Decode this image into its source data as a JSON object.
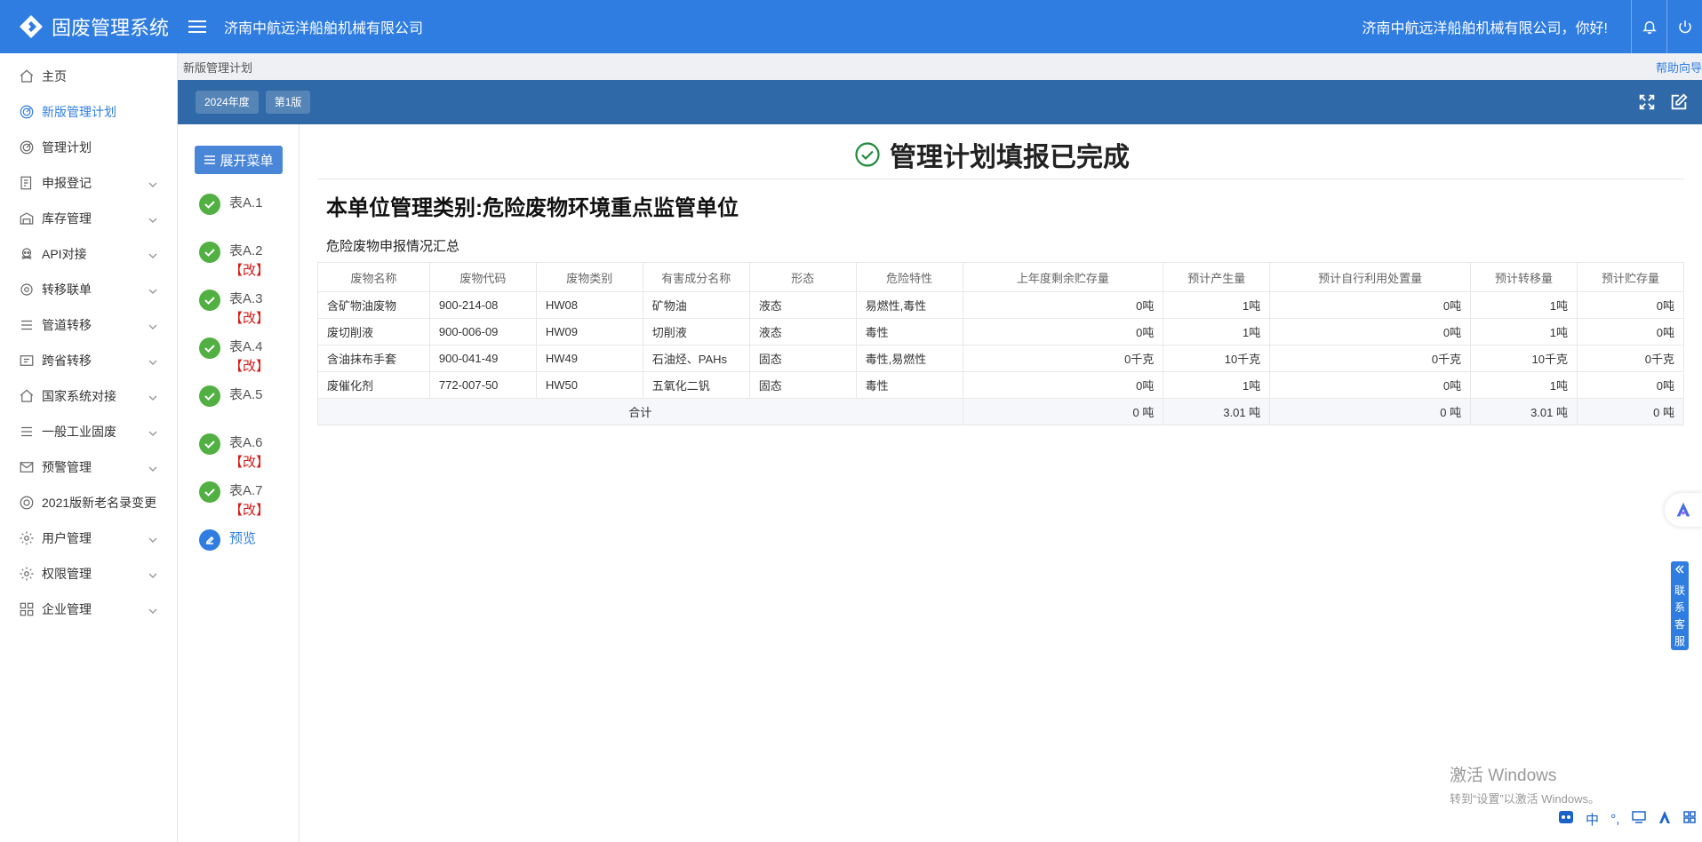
{
  "header": {
    "app_title": "固废管理系统",
    "company": "济南中航远洋船舶机械有限公司",
    "greeting": "济南中航远洋船舶机械有限公司，你好!"
  },
  "sidebar": {
    "items": [
      {
        "label": "主页"
      },
      {
        "label": "新版管理计划"
      },
      {
        "label": "管理计划"
      },
      {
        "label": "申报登记"
      },
      {
        "label": "库存管理"
      },
      {
        "label": "API对接"
      },
      {
        "label": "转移联单"
      },
      {
        "label": "管道转移"
      },
      {
        "label": "跨省转移"
      },
      {
        "label": "国家系统对接"
      },
      {
        "label": "一般工业固废"
      },
      {
        "label": "预警管理"
      },
      {
        "label": "2021版新老名录变更"
      },
      {
        "label": "用户管理"
      },
      {
        "label": "权限管理"
      },
      {
        "label": "企业管理"
      }
    ]
  },
  "breadcrumb": {
    "current": "新版管理计划",
    "help": "帮助向导"
  },
  "toolbar": {
    "year": "2024年度",
    "version": "第1版"
  },
  "steps": {
    "expand": "展开菜单",
    "modified": "【改】",
    "items": [
      {
        "label": "表A.1"
      },
      {
        "label": "表A.2"
      },
      {
        "label": "表A.3"
      },
      {
        "label": "表A.4"
      },
      {
        "label": "表A.5"
      },
      {
        "label": "表A.6"
      },
      {
        "label": "表A.7"
      },
      {
        "label": "预览"
      }
    ]
  },
  "main": {
    "status_title": "管理计划填报已完成",
    "category_title": "本单位管理类别:危险废物环境重点监管单位",
    "summary_title": "危险废物申报情况汇总",
    "table": {
      "headers": [
        "废物名称",
        "废物代码",
        "废物类别",
        "有害成分名称",
        "形态",
        "危险特性",
        "上年度剩余贮存量",
        "预计产生量",
        "预计自行利用处置量",
        "预计转移量",
        "预计贮存量"
      ],
      "rows": [
        [
          "含矿物油废物",
          "900-214-08",
          "HW08",
          "矿物油",
          "液态",
          "易燃性,毒性",
          "0吨",
          "1吨",
          "0吨",
          "1吨",
          "0吨"
        ],
        [
          "废切削液",
          "900-006-09",
          "HW09",
          "切削液",
          "液态",
          "毒性",
          "0吨",
          "1吨",
          "0吨",
          "1吨",
          "0吨"
        ],
        [
          "含油抹布手套",
          "900-041-49",
          "HW49",
          "石油烃、PAHs",
          "固态",
          "毒性,易燃性",
          "0千克",
          "10千克",
          "0千克",
          "10千克",
          "0千克"
        ],
        [
          "废催化剂",
          "772-007-50",
          "HW50",
          "五氧化二钒",
          "固态",
          "毒性",
          "0吨",
          "1吨",
          "0吨",
          "1吨",
          "0吨"
        ]
      ],
      "total": {
        "label": "合计",
        "values": [
          "0 吨",
          "3.01 吨",
          "0 吨",
          "3.01 吨",
          "0 吨"
        ]
      }
    }
  },
  "service": {
    "label_chars": [
      "联",
      "系",
      "客",
      "服"
    ]
  },
  "watermark": {
    "line1": "激活 Windows",
    "line2": "转到“设置”以激活 Windows。"
  },
  "taskbar": {
    "ime": "中"
  }
}
